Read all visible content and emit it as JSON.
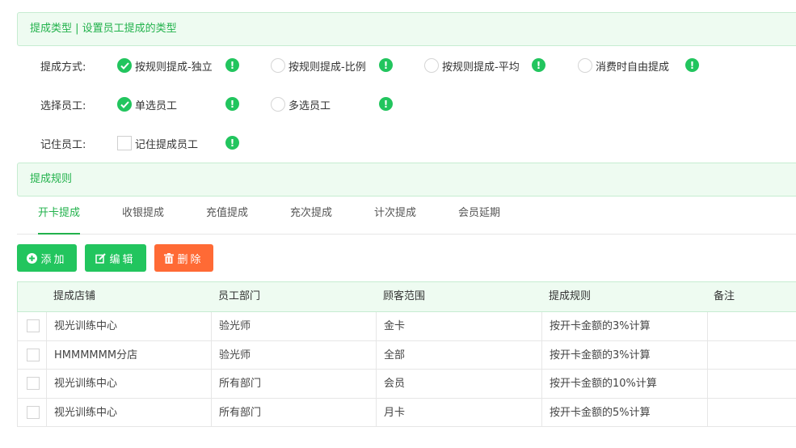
{
  "section1": {
    "title": "提成类型 | 设置员工提成的类型"
  },
  "method": {
    "label": "提成方式:",
    "options": [
      {
        "label": "按规则提成-独立",
        "checked": true
      },
      {
        "label": "按规则提成-比例",
        "checked": false
      },
      {
        "label": "按规则提成-平均",
        "checked": false
      },
      {
        "label": "消费时自由提成",
        "checked": false
      }
    ]
  },
  "staff_select": {
    "label": "选择员工:",
    "options": [
      {
        "label": "单选员工",
        "checked": true
      },
      {
        "label": "多选员工",
        "checked": false
      }
    ]
  },
  "remember": {
    "label": "记住员工:",
    "option": "记住提成员工",
    "checked": false
  },
  "info_glyph": "!",
  "section2": {
    "title": "提成规则"
  },
  "tabs": [
    {
      "label": "开卡提成",
      "active": true
    },
    {
      "label": "收银提成",
      "active": false
    },
    {
      "label": "充值提成",
      "active": false
    },
    {
      "label": "充次提成",
      "active": false
    },
    {
      "label": "计次提成",
      "active": false
    },
    {
      "label": "会员延期",
      "active": false
    }
  ],
  "toolbar": {
    "add": "添加",
    "edit": "编辑",
    "delete": "删除"
  },
  "table": {
    "columns": [
      "提成店铺",
      "员工部门",
      "顾客范围",
      "提成规则",
      "备注"
    ],
    "rows": [
      [
        "视光训练中心",
        "验光师",
        "金卡",
        "按开卡金额的3%计算",
        ""
      ],
      [
        "HMMMMMM分店",
        "验光师",
        "全部",
        "按开卡金额的3%计算",
        ""
      ],
      [
        "视光训练中心",
        "所有部门",
        "会员",
        "按开卡金额的10%计算",
        ""
      ],
      [
        "视光训练中心",
        "所有部门",
        "月卡",
        "按开卡金额的5%计算",
        ""
      ]
    ]
  },
  "colors": {
    "accent": "#22c55e",
    "accent_text": "#22b24c",
    "danger": "#ff6a35",
    "header_bg": "#eefbf1"
  }
}
